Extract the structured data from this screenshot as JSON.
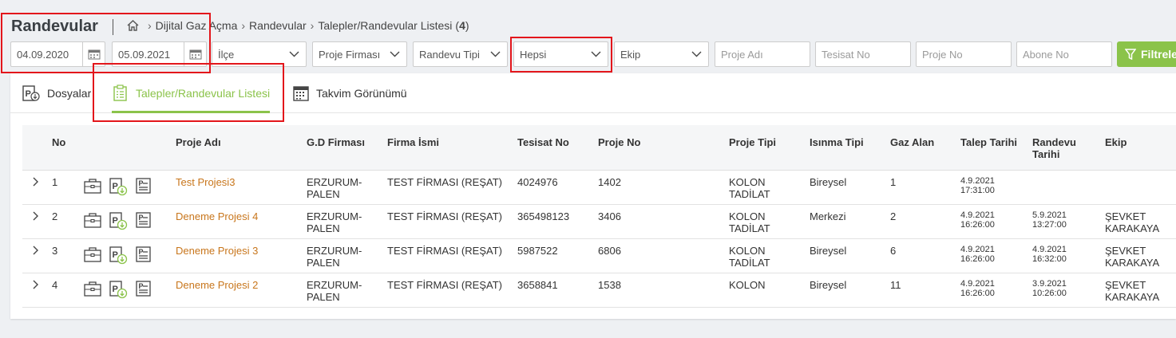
{
  "page": {
    "title": "Randevular"
  },
  "breadcrumb": {
    "items": [
      "Dijital Gaz Açma",
      "Randevular",
      "Talepler/Randevular Listesi"
    ],
    "count": "4"
  },
  "filters": {
    "date_from": "04.09.2020",
    "date_to": "05.09.2021",
    "ilce": "İlçe",
    "proje_firmasi": "Proje Firması",
    "randevu_tipi": "Randevu Tipi",
    "status": "Hepsi",
    "ekip": "Ekip",
    "proje_adi_placeholder": "Proje Adı",
    "tesisat_no_placeholder": "Tesisat No",
    "proje_no_placeholder": "Proje No",
    "abone_no_placeholder": "Abone No",
    "button_label": "Filtrele"
  },
  "tabs": [
    {
      "label": "Dosyalar",
      "icon": "document-p-icon"
    },
    {
      "label": "Talepler/Randevular Listesi",
      "icon": "clipboard-list-icon",
      "active": true
    },
    {
      "label": "Takvim Görünümü",
      "icon": "calendar-icon"
    }
  ],
  "table": {
    "headers": {
      "no": "No",
      "proje_adi": "Proje Adı",
      "gd_firmasi": "G.D Firması",
      "firma_ismi": "Firma İsmi",
      "tesisat_no": "Tesisat No",
      "proje_no": "Proje No",
      "proje_tipi": "Proje Tipi",
      "isinma_tipi": "Isınma Tipi",
      "gaz_alan": "Gaz Alan",
      "talep_tarihi": "Talep Tarihi",
      "randevu_tarihi_1": "Randevu",
      "randevu_tarihi_2": "Tarihi",
      "ekip": "Ekip"
    },
    "rows": [
      {
        "no": "1",
        "proje_adi": "Test Projesi3",
        "gd1": "ERZURUM-",
        "gd2": "PALEN",
        "firma": "TEST FİRMASI (REŞAT)",
        "tesisat": "4024976",
        "proje_no": "1402",
        "tip1": "KOLON",
        "tip2": "TADİLAT",
        "isinma": "Bireysel",
        "gaz": "1",
        "talep_d": "4.9.2021",
        "talep_t": "17:31:00",
        "randevu_d": "",
        "randevu_t": "",
        "ekip1": "",
        "ekip2": ""
      },
      {
        "no": "2",
        "proje_adi": "Deneme Projesi 4",
        "gd1": "ERZURUM-",
        "gd2": "PALEN",
        "firma": "TEST FİRMASI (REŞAT)",
        "tesisat": "365498123",
        "proje_no": "3406",
        "tip1": "KOLON",
        "tip2": "TADİLAT",
        "isinma": "Merkezi",
        "gaz": "2",
        "talep_d": "4.9.2021",
        "talep_t": "16:26:00",
        "randevu_d": "5.9.2021",
        "randevu_t": "13:27:00",
        "ekip1": "ŞEVKET",
        "ekip2": "KARAKAYA"
      },
      {
        "no": "3",
        "proje_adi": "Deneme Projesi 3",
        "gd1": "ERZURUM-",
        "gd2": "PALEN",
        "firma": "TEST FİRMASI (REŞAT)",
        "tesisat": "5987522",
        "proje_no": "6806",
        "tip1": "KOLON",
        "tip2": "TADİLAT",
        "isinma": "Bireysel",
        "gaz": "6",
        "talep_d": "4.9.2021",
        "talep_t": "16:26:00",
        "randevu_d": "4.9.2021",
        "randevu_t": "16:32:00",
        "ekip1": "ŞEVKET",
        "ekip2": "KARAKAYA"
      },
      {
        "no": "4",
        "proje_adi": "Deneme Projesi 2",
        "gd1": "ERZURUM-",
        "gd2": "PALEN",
        "firma": "TEST FİRMASI (REŞAT)",
        "tesisat": "3658841",
        "proje_no": "1538",
        "tip1": "KOLON",
        "tip2": "",
        "isinma": "Bireysel",
        "gaz": "11",
        "talep_d": "4.9.2021",
        "talep_t": "16:26:00",
        "randevu_d": "3.9.2021",
        "randevu_t": "10:26:00",
        "ekip1": "ŞEVKET",
        "ekip2": "KARAKAYA"
      }
    ]
  },
  "colors": {
    "accent": "#8bc34a",
    "link": "#c8761c",
    "highlight": "#e3161b"
  }
}
